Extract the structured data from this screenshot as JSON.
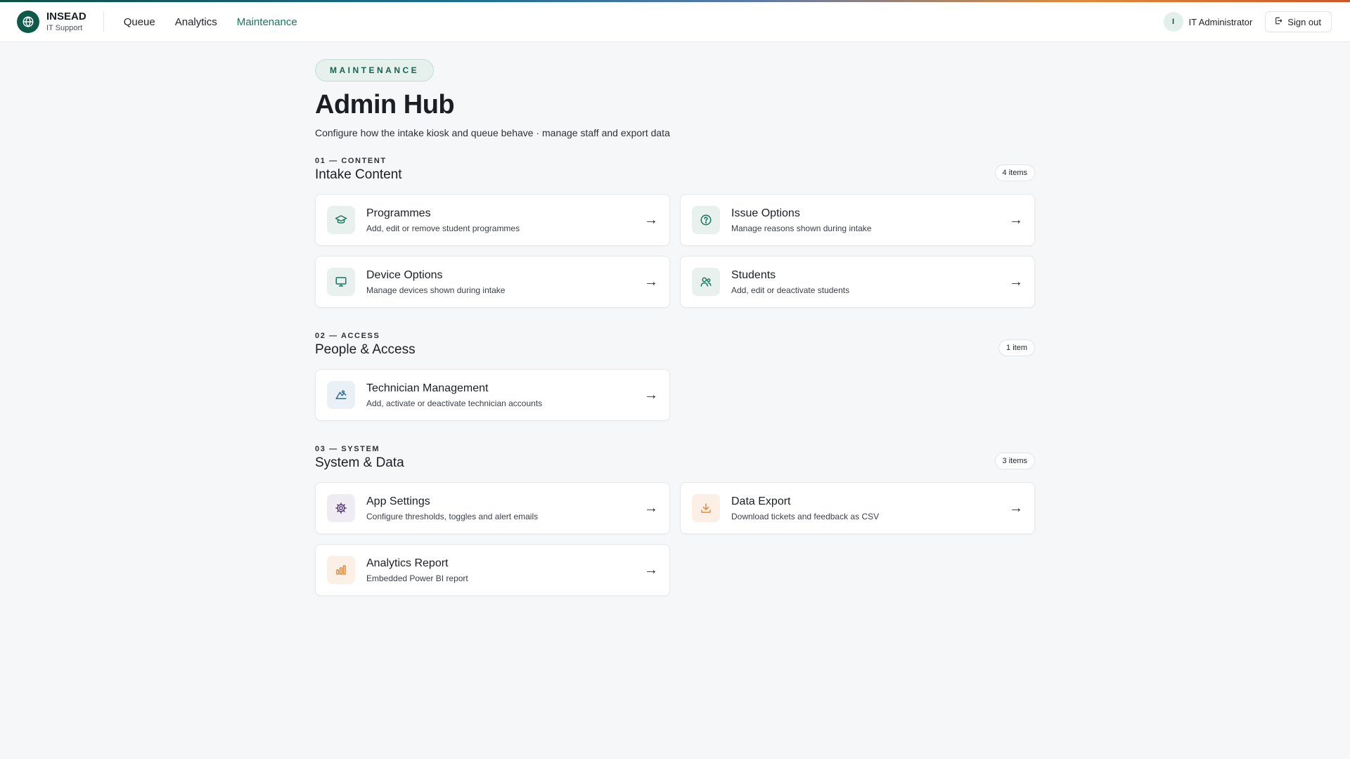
{
  "brand": {
    "name": "INSEAD",
    "sub": "IT Support"
  },
  "nav": {
    "items": [
      {
        "label": "Queue",
        "active": false
      },
      {
        "label": "Analytics",
        "active": false
      },
      {
        "label": "Maintenance",
        "active": true
      }
    ]
  },
  "user": {
    "initial": "I",
    "name": "IT Administrator",
    "signout_label": "Sign out"
  },
  "page": {
    "pill": "MAINTENANCE",
    "title": "Admin Hub",
    "subtitle": "Configure how the intake kiosk and queue behave · manage staff and export data"
  },
  "sections": [
    {
      "label": "01 — CONTENT",
      "title": "Intake Content",
      "count": "4 items",
      "cards": [
        {
          "title": "Programmes",
          "desc": "Add, edit or remove student programmes",
          "icon": "graduation-cap-icon"
        },
        {
          "title": "Issue Options",
          "desc": "Manage reasons shown during intake",
          "icon": "question-circle-icon"
        },
        {
          "title": "Device Options",
          "desc": "Manage devices shown during intake",
          "icon": "monitor-icon"
        },
        {
          "title": "Students",
          "desc": "Add, edit or deactivate students",
          "icon": "users-icon"
        }
      ]
    },
    {
      "label": "02 — ACCESS",
      "title": "People & Access",
      "count": "1 item",
      "cards": [
        {
          "title": "Technician Management",
          "desc": "Add, activate or deactivate technician accounts",
          "icon": "technician-icon"
        }
      ]
    },
    {
      "label": "03 — SYSTEM",
      "title": "System & Data",
      "count": "3 items",
      "cards": [
        {
          "title": "App Settings",
          "desc": "Configure thresholds, toggles and alert emails",
          "icon": "gear-icon"
        },
        {
          "title": "Data Export",
          "desc": "Download tickets and feedback as CSV",
          "icon": "download-icon"
        },
        {
          "title": "Analytics Report",
          "desc": "Embedded Power BI report",
          "icon": "bar-chart-icon"
        }
      ]
    }
  ],
  "arrow_glyph": "→",
  "colors": {
    "accent_green": "#17765d",
    "brand_dark": "#0e5a48",
    "icon_blue": "#2c6f94",
    "icon_purple": "#5b3f7a",
    "icon_orange": "#e08a3c",
    "background": "#f6f7f8"
  }
}
